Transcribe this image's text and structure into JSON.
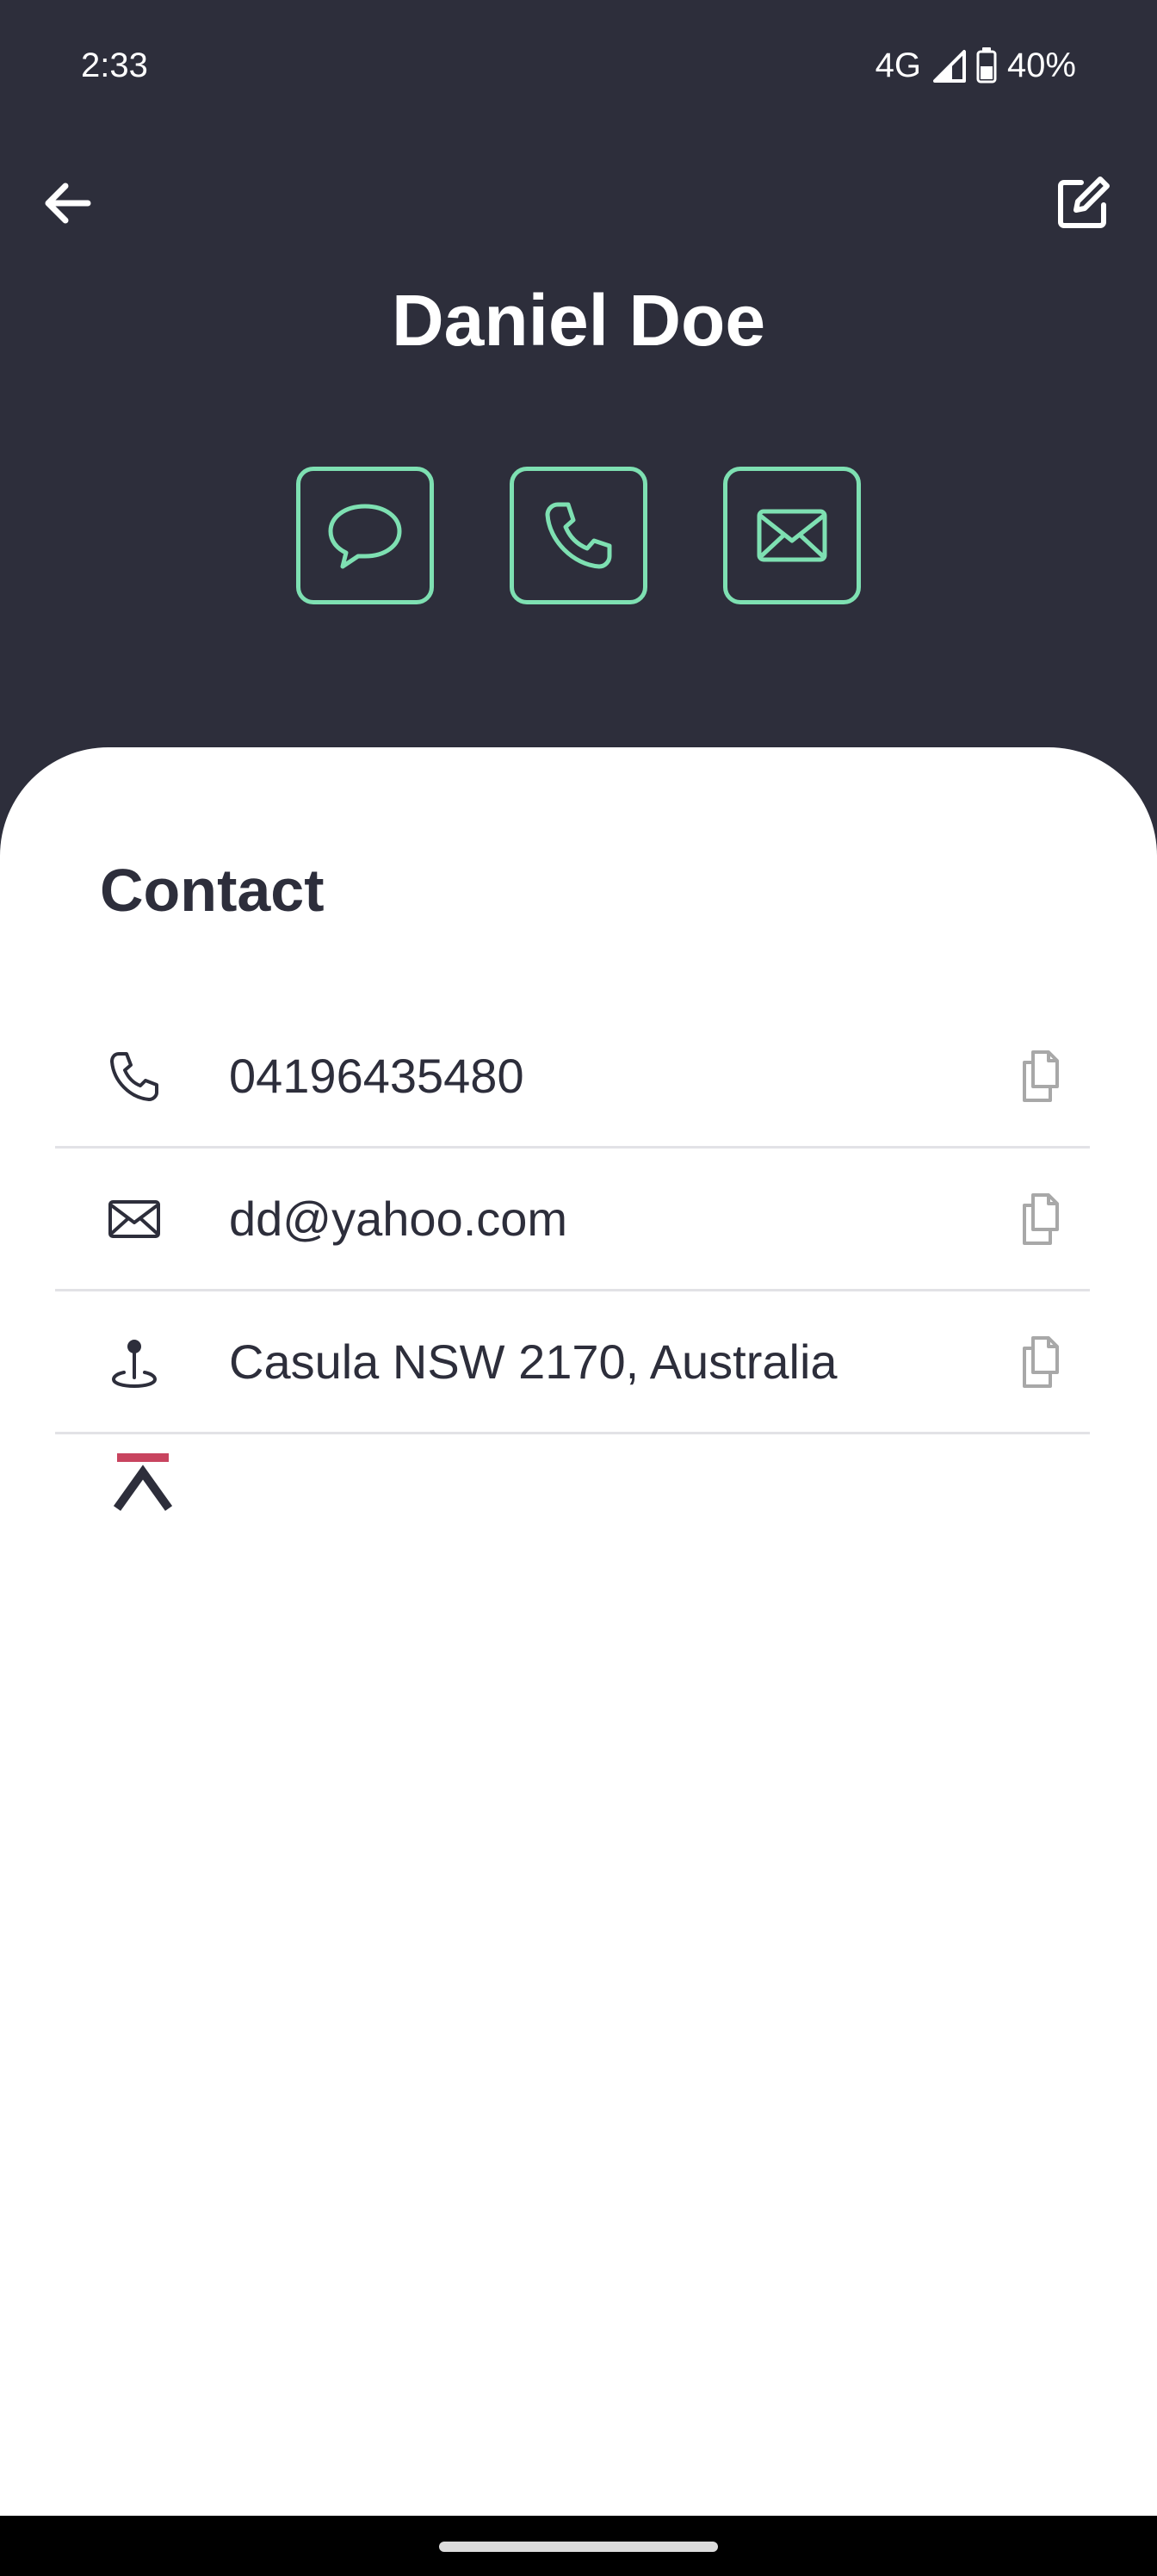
{
  "status_bar": {
    "time": "2:33",
    "network": "4G",
    "battery": "40%"
  },
  "contact": {
    "name": "Daniel Doe"
  },
  "section": {
    "title": "Contact"
  },
  "rows": {
    "phone": "04196435480",
    "email": "dd@yahoo.com",
    "address": "Casula NSW 2170, Australia"
  },
  "colors": {
    "header_bg": "#2d2e3b",
    "accent": "#7ee0b2",
    "card_bg": "#ffffff",
    "text": "#2d2e3b",
    "divider": "#e2e2e6",
    "copy_icon": "#a8a8a8",
    "logo_accent": "#c8445f"
  },
  "icons": {
    "back": "arrow-left-icon",
    "edit": "edit-square-icon",
    "message": "chat-bubble-icon",
    "call": "phone-icon",
    "mail": "envelope-icon",
    "location": "location-pin-icon",
    "copy": "copy-icon",
    "logo": "brand-logo-icon"
  }
}
